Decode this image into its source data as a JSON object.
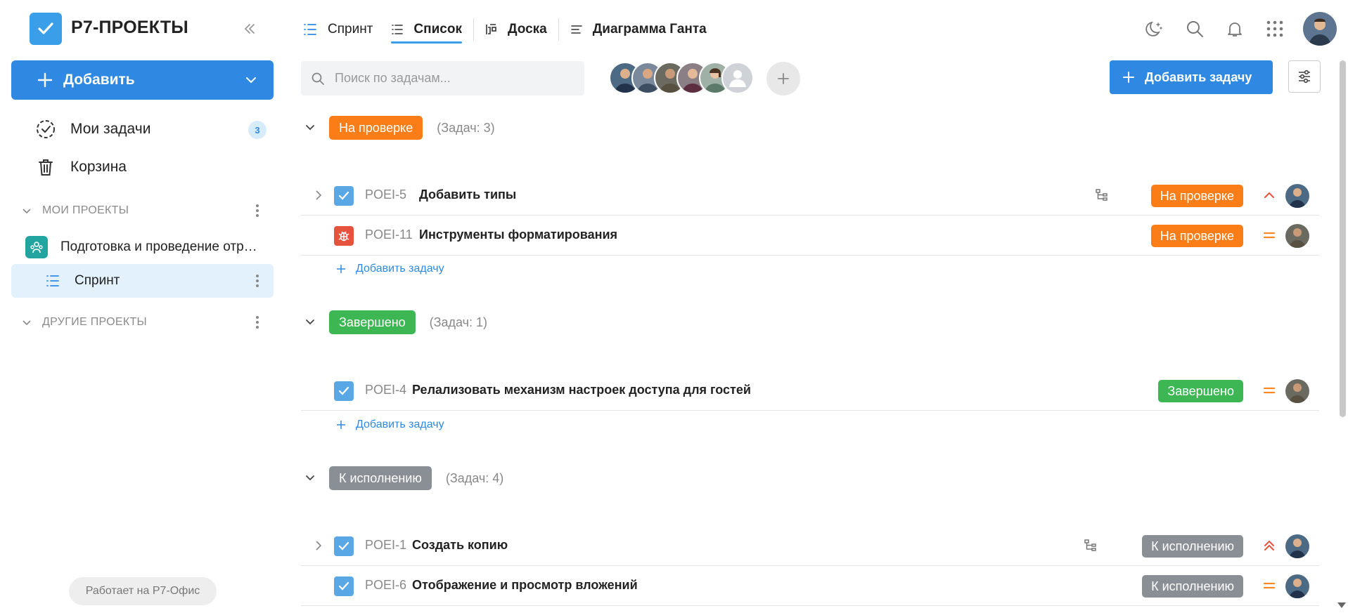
{
  "app": {
    "title": "Р7-ПРОЕКТЫ"
  },
  "sidebar": {
    "add_label": "Добавить",
    "items": [
      {
        "label": "Мои задачи",
        "count": "3"
      },
      {
        "label": "Корзина"
      }
    ],
    "my_projects_label": "МОИ ПРОЕКТЫ",
    "project_label": "Подготовка и проведение отраслевой конференции",
    "sprint_label": "Спринт",
    "other_projects_label": "ДРУГИЕ ПРОЕКТЫ",
    "footer": "Работает на Р7-Офис"
  },
  "header": {
    "title": "Спринт",
    "tabs": [
      {
        "label": "Список",
        "icon": "list-icon",
        "active": true
      },
      {
        "label": "Доска",
        "icon": "board-icon",
        "active": false
      },
      {
        "label": "Диаграмма Ганта",
        "icon": "gantt-icon",
        "active": false
      }
    ],
    "icons": [
      "theme-moon-icon",
      "search-icon",
      "bell-icon",
      "apps-grid-icon",
      "user-avatar"
    ]
  },
  "toolbar": {
    "search_placeholder": "Поиск по задачам...",
    "add_task_label": "Добавить задачу"
  },
  "colors": {
    "accent": "#2f89e3",
    "orange": "#fb7d17",
    "green": "#3cb754",
    "gray": "#8a8f96",
    "bug": "#e5533d"
  },
  "groups": [
    {
      "status": "На проверке",
      "count_label": "(Задач: 3)",
      "add_label": "Добавить задачу",
      "tasks": [
        {
          "code": "POEI-5",
          "title": "Добавить типы",
          "status": "На проверке",
          "priority": "high",
          "type": "task",
          "has_children": true
        },
        {
          "code": "POEI-11",
          "title": "Инструменты форматирования",
          "status": "На проверке",
          "priority": "medium",
          "type": "bug",
          "has_children": false
        }
      ]
    },
    {
      "status": "Завершено",
      "count_label": "(Задач: 1)",
      "add_label": "Добавить задачу",
      "tasks": [
        {
          "code": "POEI-4",
          "title": "Релализовать механизм настроек доступа для гостей",
          "status": "Завершено",
          "priority": "medium",
          "type": "task",
          "has_children": false
        }
      ]
    },
    {
      "status": "К исполнению",
      "count_label": "(Задач: 4)",
      "tasks": [
        {
          "code": "POEI-1",
          "title": "Создать копию",
          "status": "К исполнению",
          "priority": "highest",
          "type": "task",
          "has_children": true
        },
        {
          "code": "POEI-6",
          "title": "Отображение и просмотр вложений",
          "status": "К исполнению",
          "priority": "medium",
          "type": "task",
          "has_children": false
        }
      ]
    }
  ]
}
